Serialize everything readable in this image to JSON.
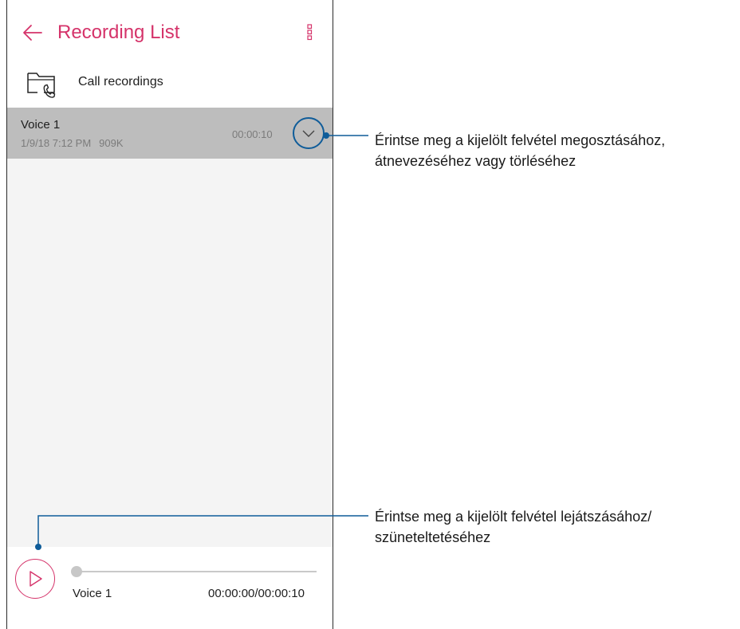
{
  "header": {
    "title": "Recording List"
  },
  "folder": {
    "label": "Call recordings"
  },
  "recordings": [
    {
      "name": "Voice 1",
      "date": "1/9/18 7:12 PM",
      "size": "909K",
      "duration": "00:00:10"
    }
  ],
  "player": {
    "track_name": "Voice 1",
    "time": "00:00:00/00:00:10",
    "progress": 0
  },
  "callouts": {
    "expand": [
      "Érintse meg a kijelölt felvétel megosztásához,",
      "átnevezéséhez vagy törléséhez"
    ],
    "play": [
      "Érintse meg a kijelölt felvétel lejátszásához/",
      "szüneteltetéséhez"
    ]
  },
  "colors": {
    "accent": "#d5336a",
    "callout_line": "#0f5c99",
    "selected_row": "#bdbdbd",
    "list_bg": "#f4f4f4"
  },
  "icons": {
    "back": "arrow-left-icon",
    "menu": "overflow-menu-icon",
    "folder": "call-folder-icon",
    "expand": "chevron-down-icon",
    "play": "play-icon"
  }
}
